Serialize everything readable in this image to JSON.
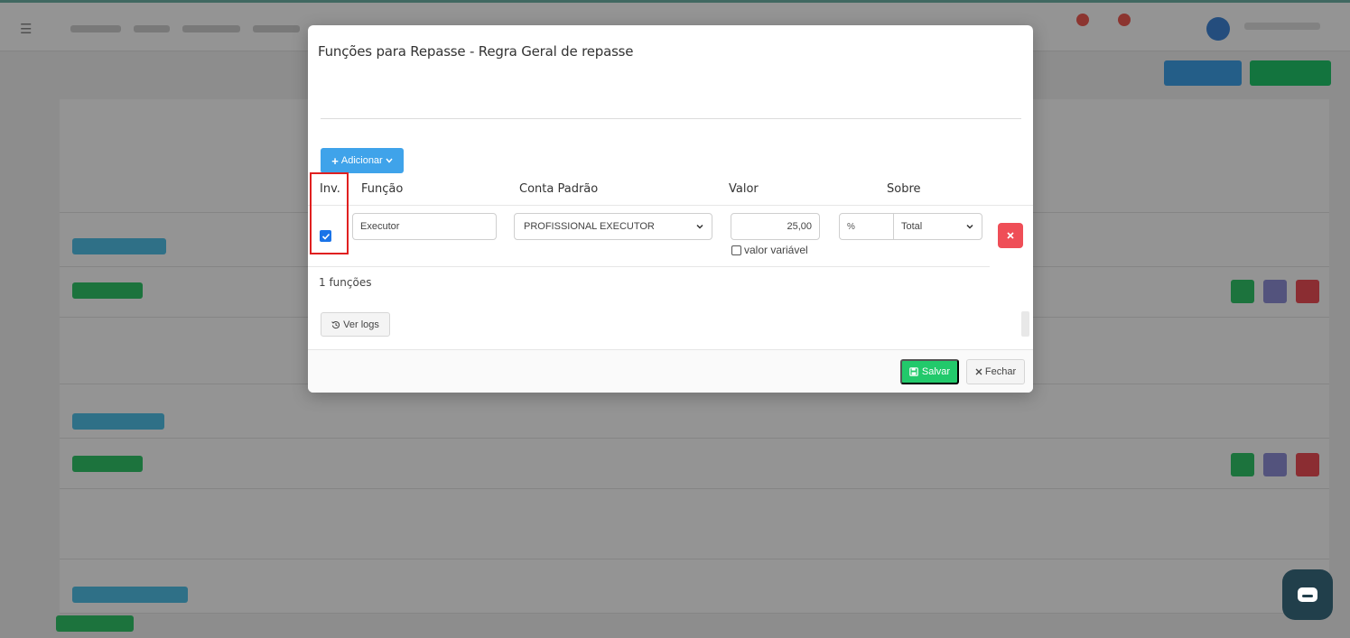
{
  "modal": {
    "title": "Funções para Repasse - Regra Geral de repasse",
    "add_button_label": "Adicionar",
    "columns": {
      "inv": "Inv.",
      "funcao": "Função",
      "conta_padrao": "Conta Padrão",
      "valor": "Valor",
      "sobre": "Sobre"
    },
    "rows": [
      {
        "inv_checked": true,
        "funcao": "Executor",
        "conta_padrao": "PROFISSIONAL EXECUTOR",
        "valor": "25,00",
        "valor_variavel_label": "valor variável",
        "valor_variavel_checked": false,
        "unit": "%",
        "sobre": "Total"
      }
    ],
    "count_text": "1 funções",
    "logs_button_label": "Ver logs",
    "save_button_label": "Salvar",
    "close_button_label": "Fechar"
  },
  "colors": {
    "primary_blue": "#3fa3ea",
    "save_green": "#22c96b",
    "delete_red": "#ef4e57",
    "highlight_red": "#e02020",
    "checkbox_blue": "#1a73e8"
  },
  "icons": {
    "add": "plus-icon",
    "dropdown": "chevron-down-icon",
    "delete": "close-icon",
    "logs": "history-icon",
    "save": "save-icon",
    "close": "close-icon",
    "chat": "chat-icon"
  }
}
